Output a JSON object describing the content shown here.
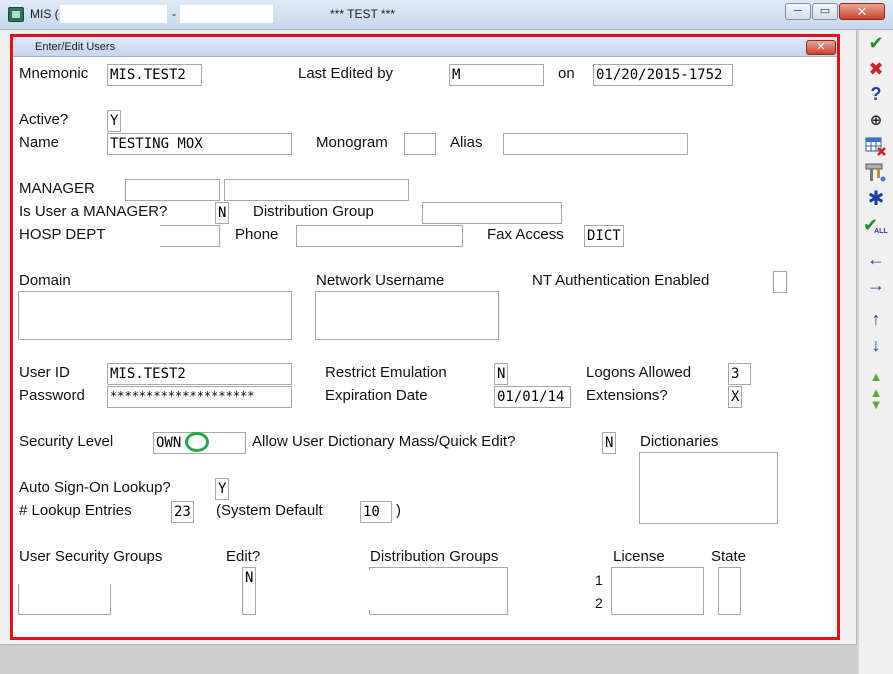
{
  "window": {
    "app_name": "MIS (",
    "separator": "-",
    "env_label": "*** TEST ***",
    "minimize_label": "─",
    "maximize_label": "▭",
    "close_label": "✕"
  },
  "dialog": {
    "title": "Enter/Edit Users",
    "close_label": "✕"
  },
  "labels": {
    "mnemonic": "Mnemonic",
    "last_edited_by": "Last Edited by",
    "on": "on",
    "active": "Active?",
    "name": "Name",
    "monogram": "Monogram",
    "alias": "Alias",
    "manager": "MANAGER",
    "is_user_manager": "Is User a MANAGER?",
    "distribution_group": "Distribution Group",
    "hosp_dept": "HOSP DEPT",
    "phone": "Phone",
    "fax_access": "Fax Access",
    "domain": "Domain",
    "network_username": "Network Username",
    "nt_auth": "NT Authentication Enabled",
    "user_id": "User ID",
    "restrict_emulation": "Restrict Emulation",
    "logons_allowed": "Logons Allowed",
    "password": "Password",
    "expiration_date": "Expiration Date",
    "extensions": "Extensions?",
    "security_level": "Security Level",
    "allow_dict": "Allow User Dictionary Mass/Quick Edit?",
    "dictionaries": "Dictionaries",
    "auto_signon": "Auto Sign-On Lookup?",
    "lookup_entries": "# Lookup Entries",
    "system_default": "(System Default",
    "close_paren": ")",
    "user_security_groups": "User Security Groups",
    "edit": "Edit?",
    "distribution_groups": "Distribution Groups",
    "license": "License",
    "state": "State",
    "row1": "1",
    "row2": "2"
  },
  "values": {
    "mnemonic": "MIS.TEST2",
    "last_edited_by": "M",
    "edited_on": "01/20/2015-1752",
    "active": "Y",
    "name": "TESTING MOX",
    "monogram": "",
    "alias": "",
    "manager_code": "",
    "manager_name": "",
    "is_user_manager": "N",
    "distribution_group": "",
    "hosp_dept": "",
    "phone": "",
    "fax_access": "DICT",
    "user_id": "MIS.TEST2",
    "restrict_emulation": "N",
    "logons_allowed": "3",
    "password": "********************",
    "expiration_date": "01/01/14",
    "extensions": "X",
    "security_level": "OWN",
    "allow_dict": "N",
    "auto_signon": "Y",
    "lookup_entries": "23",
    "system_default": "10",
    "security_group_edit": "N"
  },
  "toolbar": {
    "ok": "✔",
    "cancel": "✖",
    "help": "?",
    "find": "⊕",
    "asterisk": "✱",
    "ok_all": "✔",
    "ok_all_sub": "ALL",
    "left": "←",
    "right": "→",
    "up": "↑",
    "down": "↓",
    "page_up": "▲",
    "page_down": "▼"
  },
  "colors": {
    "dialog_border": "#e3101a",
    "annotation_circle": "#27a844",
    "toolbar_green": "#1f8f2e",
    "toolbar_red": "#d42020",
    "toolbar_blue": "#1c3fa8"
  }
}
